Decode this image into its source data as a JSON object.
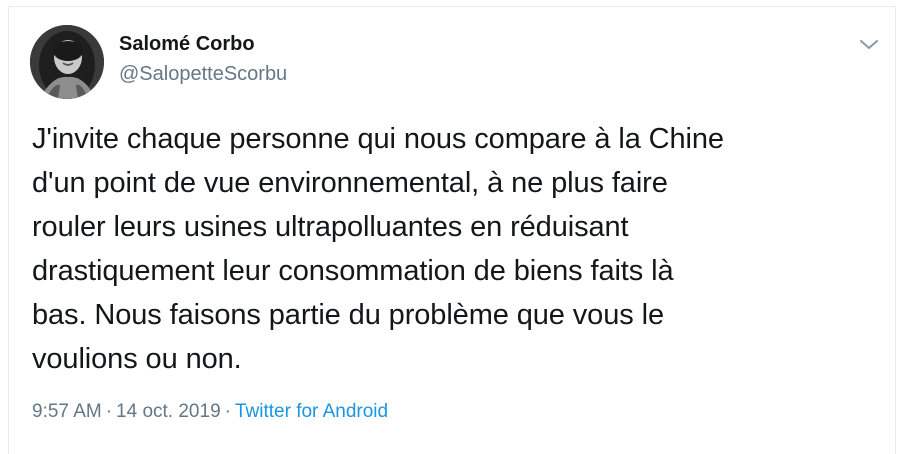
{
  "author": {
    "display_name": "Salomé Corbo",
    "handle": "@SalopetteScorbu",
    "avatar_icon": "profile-photo"
  },
  "menu": {
    "icon": "chevron-down-icon"
  },
  "tweet": {
    "text": "J'invite chaque personne qui nous compare à la Chine\nd'un point de vue environnemental, à ne plus faire\nrouler leurs usines ultrapolluantes en réduisant\ndrastiquement leur consommation de biens faits là\nbas. Nous faisons partie du problème que vous le\nvoulions ou non."
  },
  "meta": {
    "time": "9:57 AM",
    "separator1": "·",
    "date": "14 oct. 2019",
    "separator2": "·",
    "source": "Twitter for Android"
  },
  "colors": {
    "text": "#14171a",
    "secondary": "#657786",
    "link": "#1b95e0",
    "border": "#e6ecf0"
  }
}
